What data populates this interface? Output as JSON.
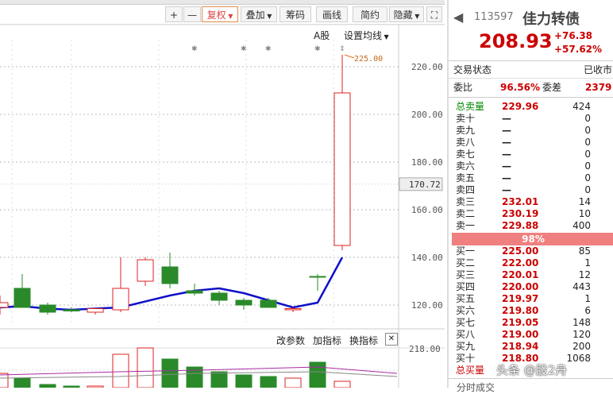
{
  "toolbar": {
    "plus": "+",
    "minus": "—",
    "fuquan": "复权",
    "diejia": "叠加",
    "chouma": "筹码",
    "huaxian": "画线",
    "jianyue": "简约",
    "yincang": "隐藏",
    "expand": "⛶"
  },
  "chart": {
    "a_share": "A股",
    "ma_settings": "设置均线",
    "high_marker": "225.00",
    "price_axis": [
      "220.00",
      "200.00",
      "180.00",
      "160.00",
      "140.00",
      "120.00"
    ],
    "current_price_tag": "170.72",
    "indicator_bar": {
      "modify_params": "改参数",
      "add_indicator": "加指标",
      "change_indicator": "换指标",
      "close": "✕"
    },
    "volume_axis": [
      "218.00"
    ]
  },
  "chart_data": {
    "type": "candlestick",
    "y_range": [
      112,
      228
    ],
    "candles": [
      {
        "o": 119,
        "h": 124,
        "l": 116,
        "c": 121,
        "color": "red"
      },
      {
        "o": 127,
        "h": 133,
        "l": 119,
        "c": 119,
        "color": "green"
      },
      {
        "o": 120,
        "h": 121,
        "l": 116,
        "c": 117,
        "color": "green"
      },
      {
        "o": 118,
        "h": 119,
        "l": 117,
        "c": 117.5,
        "color": "green"
      },
      {
        "o": 117,
        "h": 119,
        "l": 116,
        "c": 118.5,
        "color": "red"
      },
      {
        "o": 118,
        "h": 140,
        "l": 117,
        "c": 127,
        "color": "red"
      },
      {
        "o": 130,
        "h": 140,
        "l": 128,
        "c": 139,
        "color": "red"
      },
      {
        "o": 136,
        "h": 142,
        "l": 127,
        "c": 129,
        "color": "green"
      },
      {
        "o": 126,
        "h": 129,
        "l": 124,
        "c": 125,
        "color": "green"
      },
      {
        "o": 125,
        "h": 126,
        "l": 120,
        "c": 122,
        "color": "green"
      },
      {
        "o": 122,
        "h": 123,
        "l": 118,
        "c": 120,
        "color": "green"
      },
      {
        "o": 122,
        "h": 123,
        "l": 119,
        "c": 119,
        "color": "green"
      },
      {
        "o": 118,
        "h": 119,
        "l": 117,
        "c": 118.5,
        "color": "red"
      },
      {
        "o": 132,
        "h": 133,
        "l": 126,
        "c": 132,
        "color": "green"
      },
      {
        "o": 145,
        "h": 225,
        "l": 143,
        "c": 209,
        "color": "red"
      }
    ],
    "ma_line": [
      119,
      119.5,
      118.5,
      118,
      118.5,
      119,
      124,
      126,
      127,
      125,
      122,
      119,
      121,
      140
    ]
  },
  "quote": {
    "code": "113597",
    "name": "佳力转债",
    "price": "208.93",
    "change": "+76.38",
    "change_pct": "+57.62%",
    "trade_status_label": "交易状态",
    "trade_status_value": "已收市",
    "weibi_label": "委比",
    "weibi_value": "96.56%",
    "weicha_label": "委差",
    "weicha_value": "2379",
    "total_sell_label": "总卖量",
    "total_sell_price": "229.96",
    "total_sell_vol": "424",
    "sells": [
      {
        "label": "卖十",
        "price": "—",
        "vol": "0"
      },
      {
        "label": "卖九",
        "price": "—",
        "vol": "0"
      },
      {
        "label": "卖八",
        "price": "—",
        "vol": "0"
      },
      {
        "label": "卖七",
        "price": "—",
        "vol": "0"
      },
      {
        "label": "卖六",
        "price": "—",
        "vol": "0"
      },
      {
        "label": "卖五",
        "price": "—",
        "vol": "0"
      },
      {
        "label": "卖四",
        "price": "—",
        "vol": "0"
      },
      {
        "label": "卖三",
        "price": "232.01",
        "vol": "14"
      },
      {
        "label": "卖二",
        "price": "230.19",
        "vol": "10"
      },
      {
        "label": "卖一",
        "price": "229.88",
        "vol": "400"
      }
    ],
    "ratio": "98%",
    "buys": [
      {
        "label": "买一",
        "price": "225.00",
        "vol": "85"
      },
      {
        "label": "买二",
        "price": "222.00",
        "vol": "1"
      },
      {
        "label": "买三",
        "price": "220.01",
        "vol": "12"
      },
      {
        "label": "买四",
        "price": "220.00",
        "vol": "443"
      },
      {
        "label": "买五",
        "price": "219.97",
        "vol": "1"
      },
      {
        "label": "买六",
        "price": "219.80",
        "vol": "6"
      },
      {
        "label": "买七",
        "price": "219.05",
        "vol": "148"
      },
      {
        "label": "买八",
        "price": "219.00",
        "vol": "120"
      },
      {
        "label": "买九",
        "price": "218.94",
        "vol": "200"
      },
      {
        "label": "买十",
        "price": "218.80",
        "vol": "1068"
      }
    ],
    "total_buy_label": "总买量",
    "bottom_tab": "分时成交"
  },
  "watermark": "头条 @股2舟"
}
